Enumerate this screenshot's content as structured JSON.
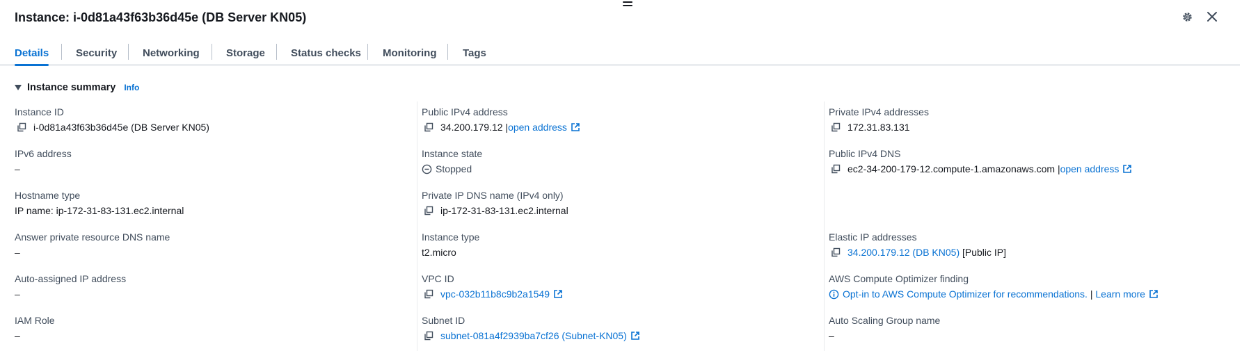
{
  "header": {
    "title": "Instance: i-0d81a43f63b36d45e (DB Server KN05)",
    "settings_icon": "gear-icon",
    "close_icon": "close-icon"
  },
  "tabs": [
    {
      "label": "Details",
      "active": true
    },
    {
      "label": "Security"
    },
    {
      "label": "Networking"
    },
    {
      "label": "Storage"
    },
    {
      "label": "Status checks"
    },
    {
      "label": "Monitoring"
    },
    {
      "label": "Tags"
    }
  ],
  "section": {
    "title": "Instance summary",
    "info_label": "Info"
  },
  "col1": {
    "instance_id": {
      "label": "Instance ID",
      "value": "i-0d81a43f63b36d45e (DB Server KN05)"
    },
    "ipv6": {
      "label": "IPv6 address",
      "value": "–"
    },
    "hostname_type": {
      "label": "Hostname type",
      "value": "IP name: ip-172-31-83-131.ec2.internal"
    },
    "answer_dns": {
      "label": "Answer private resource DNS name",
      "value": "–"
    },
    "auto_ip": {
      "label": "Auto-assigned IP address",
      "value": "–"
    },
    "iam_role": {
      "label": "IAM Role",
      "value": "–"
    }
  },
  "col2": {
    "public_ipv4": {
      "label": "Public IPv4 address",
      "value": "34.200.179.12",
      "sep": "|",
      "link": "open address"
    },
    "state": {
      "label": "Instance state",
      "value": "Stopped"
    },
    "private_dns": {
      "label": "Private IP DNS name (IPv4 only)",
      "value": "ip-172-31-83-131.ec2.internal"
    },
    "instance_type": {
      "label": "Instance type",
      "value": "t2.micro"
    },
    "vpc": {
      "label": "VPC ID",
      "value": "vpc-032b11b8c9b2a1549"
    },
    "subnet": {
      "label": "Subnet ID",
      "value": "subnet-081a4f2939ba7cf26 (Subnet-KN05)"
    }
  },
  "col3": {
    "private_ipv4": {
      "label": "Private IPv4 addresses",
      "value": "172.31.83.131"
    },
    "public_dns": {
      "label": "Public IPv4 DNS",
      "value": "ec2-34-200-179-12.compute-1.amazonaws.com",
      "sep": "|",
      "link": "open address"
    },
    "elastic_ip": {
      "label": "Elastic IP addresses",
      "value": "34.200.179.12 (DB KN05)",
      "suffix": "[Public IP]"
    },
    "optimizer": {
      "label": "AWS Compute Optimizer finding",
      "value": "Opt-in to AWS Compute Optimizer for recommendations.",
      "sep": "|",
      "link": "Learn more"
    },
    "asg": {
      "label": "Auto Scaling Group name",
      "value": "–"
    }
  },
  "colors": {
    "link": "#0972d3",
    "text": "#16191f",
    "label": "#414d5c",
    "divider": "#b6bec9"
  }
}
